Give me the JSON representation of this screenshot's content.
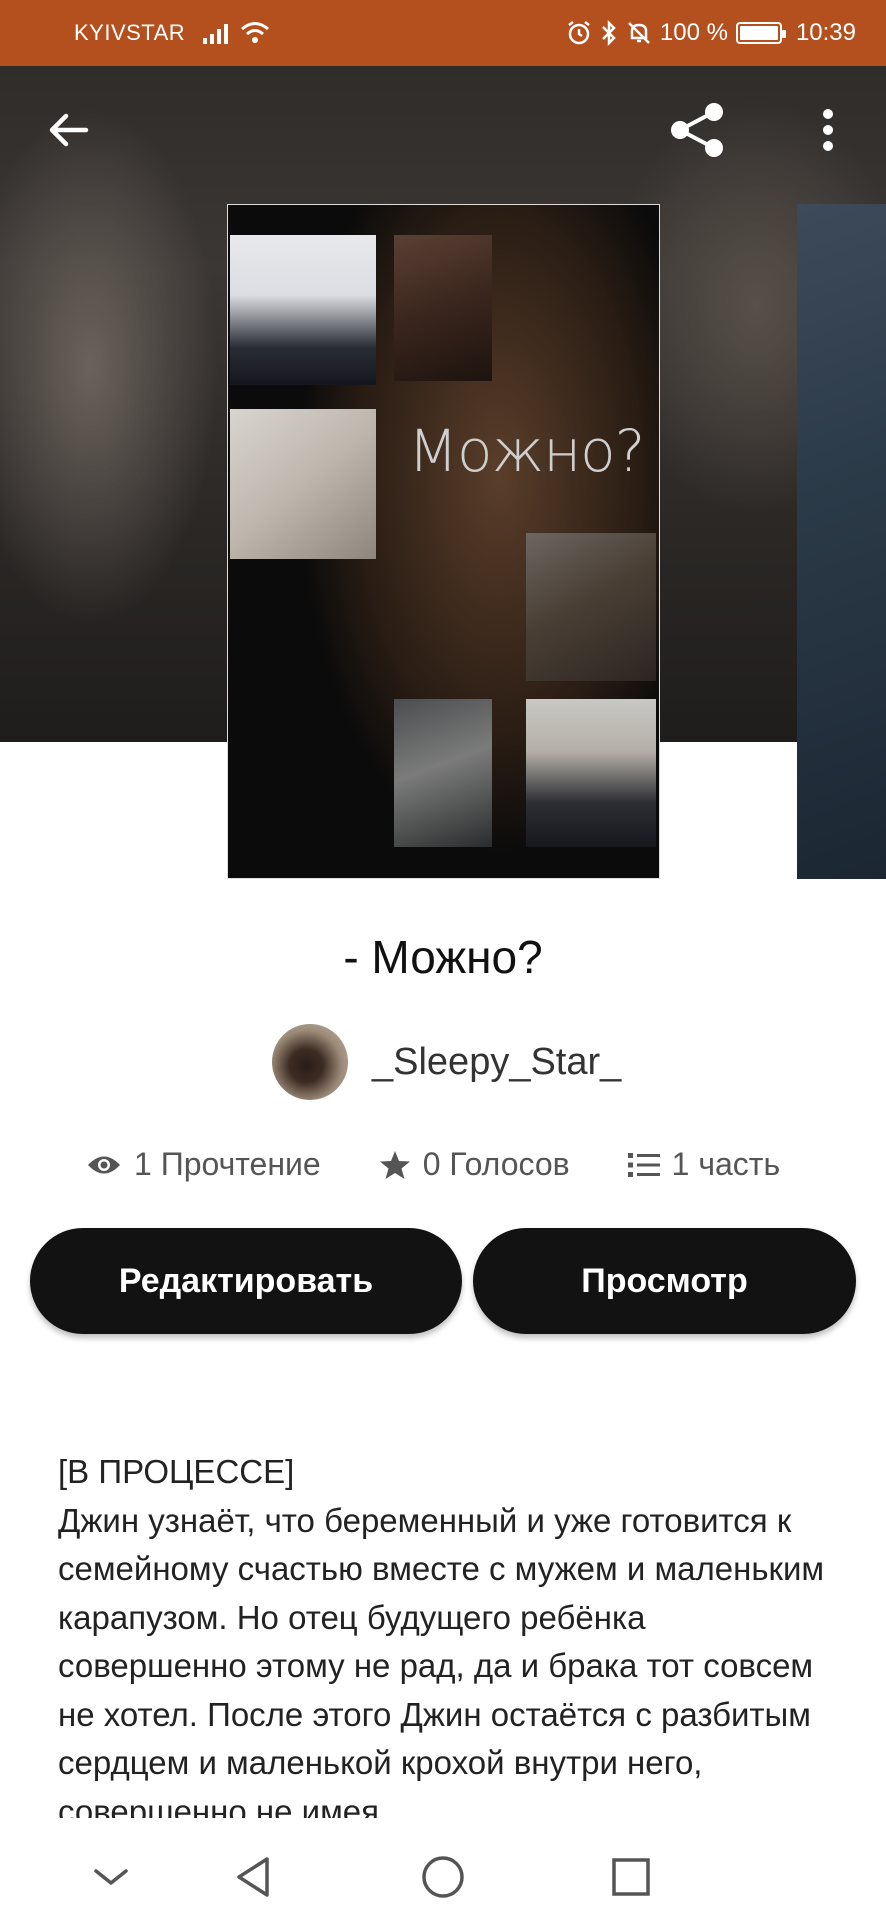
{
  "status_bar": {
    "carrier": "KYIVSTAR",
    "battery": "100 %",
    "time": "10:39",
    "icons": [
      "signal-icon",
      "wifi-icon",
      "alarm-icon",
      "bluetooth-icon",
      "mute-icon",
      "battery-icon"
    ]
  },
  "hero": {
    "cover_title_text": "Можно?",
    "icons": [
      "back-arrow-icon",
      "share-icon",
      "more-vertical-icon"
    ]
  },
  "story": {
    "title": "- Можно?",
    "author": "_Sleepy_Star_"
  },
  "stats": {
    "reads": "1 Прочтение",
    "votes": "0 Голосов",
    "parts": "1 часть",
    "icons": [
      "eye-icon",
      "star-icon",
      "list-icon"
    ]
  },
  "actions": {
    "edit_label": "Редактировать",
    "view_label": "Просмотр"
  },
  "description": {
    "status": "[В ПРОЦЕССЕ]",
    "text": "Джин узнаёт, что беременный и уже готовится к семейному счастью вместе с мужем и маленьким карапузом. Но отец будущего ребёнка совершенно этому не рад, да и брака тот совсем не хотел. После этого Джин остаётся с разбитым сердцем и маленькой крохой внутри него, совершенно не имея"
  },
  "nav_bar": {
    "icons": [
      "collapse-chevron-icon",
      "back-triangle-icon",
      "home-circle-icon",
      "recents-square-icon"
    ]
  },
  "colors": {
    "status_bar_bg": "#b4501e",
    "button_bg": "#121212",
    "text_primary": "#111111"
  }
}
